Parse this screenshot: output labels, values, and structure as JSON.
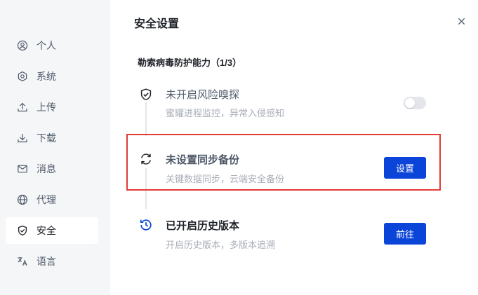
{
  "sidebar": {
    "items": [
      {
        "label": "个人",
        "icon": "user-icon"
      },
      {
        "label": "系统",
        "icon": "gear-icon"
      },
      {
        "label": "上传",
        "icon": "upload-icon"
      },
      {
        "label": "下载",
        "icon": "download-icon"
      },
      {
        "label": "消息",
        "icon": "mail-icon"
      },
      {
        "label": "代理",
        "icon": "globe-icon"
      },
      {
        "label": "安全",
        "icon": "shield-icon",
        "active": true
      },
      {
        "label": "语言",
        "icon": "language-icon"
      }
    ]
  },
  "header": {
    "title": "安全设置",
    "close_icon": "close-icon"
  },
  "section": {
    "title": "勒索病毒防护能力（1/3）"
  },
  "features": [
    {
      "title": "未开启风险嗅探",
      "subtitle": "蜜罐进程监控，异常入侵感知",
      "icon": "shield-check-icon",
      "control": "toggle",
      "enabled": false
    },
    {
      "title": "未设置同步备份",
      "subtitle": "关键数据同步，云端安全备份",
      "icon": "sync-icon",
      "control": "button",
      "button_label": "设置"
    },
    {
      "title": "已开启历史版本",
      "subtitle": "开启历史版本，多版本追溯",
      "icon": "history-icon",
      "control": "button",
      "button_label": "前往"
    }
  ],
  "colors": {
    "accent": "#0b44d8",
    "highlight_border": "#e53935",
    "sidebar_bg": "#f5f6f8"
  }
}
